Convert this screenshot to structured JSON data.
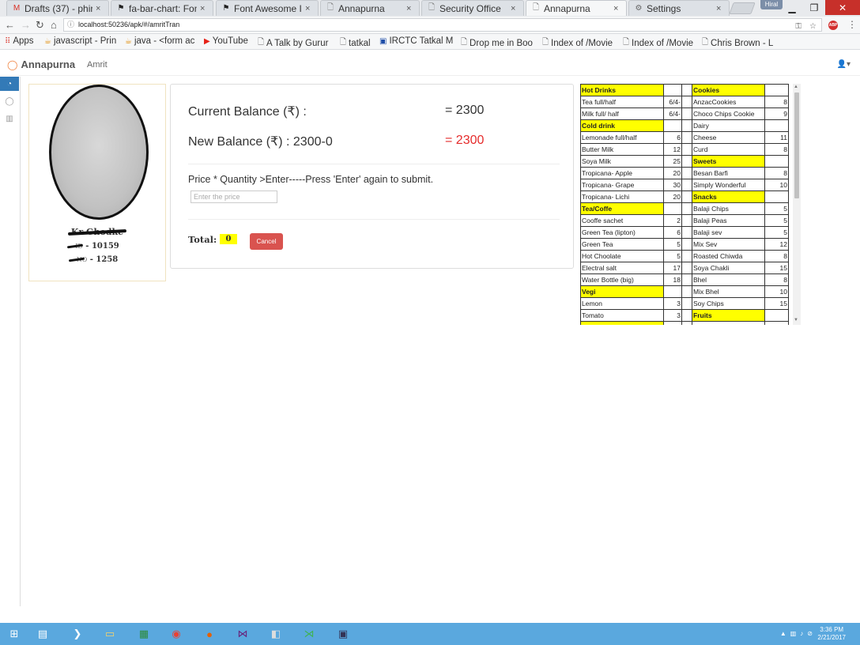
{
  "browser": {
    "tabs": [
      {
        "label": "Drafts (37) - phira",
        "icon": "gmail-icon"
      },
      {
        "label": "fa-bar-chart: Font",
        "icon": "fa-icon"
      },
      {
        "label": "Font Awesome Ic",
        "icon": "fa-icon"
      },
      {
        "label": "Annapurna",
        "icon": "page-icon"
      },
      {
        "label": "Security Office",
        "icon": "page-icon"
      },
      {
        "label": "Annapurna",
        "icon": "page-icon",
        "active": true
      },
      {
        "label": "Settings",
        "icon": "gear-icon"
      }
    ],
    "user_chip": "Hiral",
    "url": "localhost:50236/apk/#/amritTran",
    "bookmarks": [
      "Apps",
      "javascript - Prin",
      "java - <form ac",
      "YouTube",
      "A Talk by Gurur",
      "tatkal",
      "IRCTC Tatkal M",
      "Drop me in Boo",
      "Index of /Movie",
      "Index of /Movie",
      "Chris Brown - L"
    ]
  },
  "header": {
    "brand": "Annapurna",
    "user": "Amrit"
  },
  "profile": {
    "name": "Kr        Ghodke",
    "emp_label": "ID",
    "emp_id": "10159",
    "bed_label": "NO",
    "bed_no": "1258"
  },
  "transaction": {
    "current_label": "Current Balance (₹) :",
    "current_value": "= 2300",
    "new_label": "New Balance (₹) : 2300-0",
    "new_value": "= 2300",
    "instruction": "Price * Quantity >Enter-----Press 'Enter' again to submit.",
    "price_placeholder": "Enter the price",
    "total_label": "Total:",
    "total_value": "0",
    "cancel_label": "Cancel"
  },
  "menu": {
    "rows": [
      [
        {
          "t": "Hot Drinks",
          "h": true
        },
        {
          "t": ""
        },
        {
          "t": "Cookies",
          "h": true
        },
        {
          "t": ""
        }
      ],
      [
        {
          "t": "Tea full/half"
        },
        {
          "t": "6/4-"
        },
        {
          "t": "AnzacCookies"
        },
        {
          "t": "8"
        }
      ],
      [
        {
          "t": "Milk full/ half"
        },
        {
          "t": "6/4-"
        },
        {
          "t": "Choco Chips Cookie"
        },
        {
          "t": "9"
        }
      ],
      [
        {
          "t": "Cold drink",
          "h": true
        },
        {
          "t": ""
        },
        {
          "t": "Dairy"
        },
        {
          "t": ""
        }
      ],
      [
        {
          "t": "Lemonade full/half"
        },
        {
          "t": "6"
        },
        {
          "t": "Cheese"
        },
        {
          "t": "11"
        }
      ],
      [
        {
          "t": "Butter Milk"
        },
        {
          "t": "12"
        },
        {
          "t": "Curd"
        },
        {
          "t": "8"
        }
      ],
      [
        {
          "t": "Soya Milk"
        },
        {
          "t": "25"
        },
        {
          "t": "Sweets",
          "h": true
        },
        {
          "t": ""
        }
      ],
      [
        {
          "t": "Tropicana- Apple"
        },
        {
          "t": "20"
        },
        {
          "t": "Besan Barfi"
        },
        {
          "t": "8"
        }
      ],
      [
        {
          "t": "Tropicana- Grape"
        },
        {
          "t": "30"
        },
        {
          "t": "Simply Wonderful"
        },
        {
          "t": "10"
        }
      ],
      [
        {
          "t": "Tropicana- Lichi"
        },
        {
          "t": "20"
        },
        {
          "t": "Snacks",
          "h": true
        },
        {
          "t": ""
        }
      ],
      [
        {
          "t": "Tea/Coffe",
          "h": true
        },
        {
          "t": ""
        },
        {
          "t": "Balaji Chips"
        },
        {
          "t": "5"
        }
      ],
      [
        {
          "t": "Cooffe sachet"
        },
        {
          "t": "2"
        },
        {
          "t": "Balaji Peas"
        },
        {
          "t": "5"
        }
      ],
      [
        {
          "t": "Green Tea (lipton)"
        },
        {
          "t": "6"
        },
        {
          "t": "Balaji sev"
        },
        {
          "t": "5"
        }
      ],
      [
        {
          "t": "Green Tea"
        },
        {
          "t": "5"
        },
        {
          "t": "Mix Sev"
        },
        {
          "t": "12"
        }
      ],
      [
        {
          "t": "Hot Choolate"
        },
        {
          "t": "5"
        },
        {
          "t": "Roasted Chiwda"
        },
        {
          "t": "8"
        }
      ],
      [
        {
          "t": "Electral salt"
        },
        {
          "t": "17"
        },
        {
          "t": "Soya Chakli"
        },
        {
          "t": "15"
        }
      ],
      [
        {
          "t": "Water Bottle (big)"
        },
        {
          "t": "18"
        },
        {
          "t": "Bhel"
        },
        {
          "t": "8"
        }
      ],
      [
        {
          "t": "Vegi",
          "h": true
        },
        {
          "t": ""
        },
        {
          "t": "Mix Bhel"
        },
        {
          "t": "10"
        }
      ],
      [
        {
          "t": "Lemon"
        },
        {
          "t": "3"
        },
        {
          "t": "Soy Chips"
        },
        {
          "t": "15"
        }
      ],
      [
        {
          "t": "Tomato"
        },
        {
          "t": "3"
        },
        {
          "t": "Fruits",
          "h": true
        },
        {
          "t": ""
        }
      ],
      [
        {
          "t": "",
          "h": true
        },
        {
          "t": ""
        },
        {
          "t": ""
        },
        {
          "t": ""
        }
      ]
    ]
  },
  "taskbar": {
    "time": "3:36 PM",
    "date": "2/21/2017"
  }
}
